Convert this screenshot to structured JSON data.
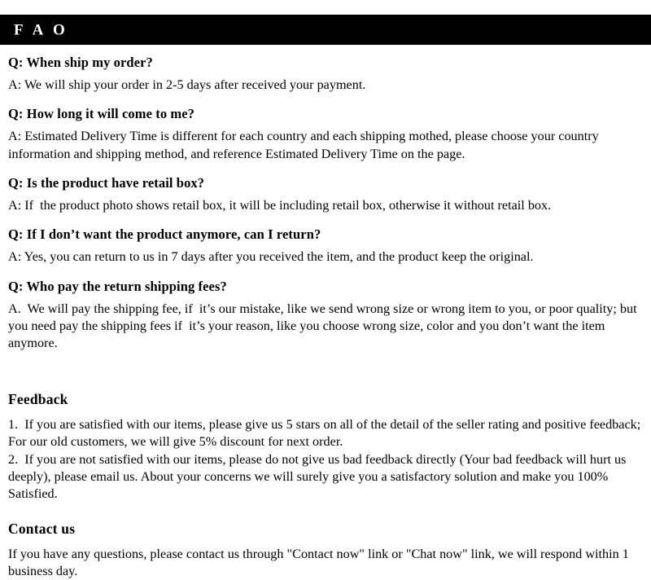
{
  "header": {
    "title": "F A O",
    "background_color": "#000000",
    "text_color": "#ffffff"
  },
  "faq": {
    "items": [
      {
        "question": "Q: When ship my order?",
        "answer": "A: We will ship your order in 2-5 days after received your payment."
      },
      {
        "question": "Q: How long it will come to me?",
        "answer": "A: Estimated Delivery Time is different for each country and each shipping mothed, please choose your country information and shipping method, and reference Estimated Delivery Time on the page."
      },
      {
        "question": "Q: Is the product have retail box?",
        "answer": "A: If  the product photo shows retail box, it will be including retail box, otherwise it without retail box."
      },
      {
        "question": "Q: If  I don’t want the product anymore, can I return?",
        "answer": "A: Yes, you can return to us in 7 days after you received the item, and the product keep the original."
      },
      {
        "question": "Q: Who pay the return shipping fees?",
        "answer": "A.  We will pay the shipping fee, if  it’s our mistake, like we send wrong size or wrong item to you, or poor quality; but you need pay the shipping fees if  it’s your reason, like you choose wrong size, color and you don’t want the item anymore."
      }
    ]
  },
  "feedback": {
    "heading": "Feedback",
    "paragraphs": [
      "1.  If you are satisfied with our items, please give us 5 stars on all of the detail of the seller rating and positive feedback; For our old customers, we will give 5% discount for next order.",
      "2.  If you are not satisfied with our items, please do not give us bad feedback directly (Your bad feedback will hurt us deeply), please email us. About your concerns we will surely give you a satisfactory solution and make you 100% Satisfied."
    ]
  },
  "contact": {
    "heading": "Contact us",
    "paragraphs": [
      "If you have any questions, please contact us through \"Contact now\" link or \"Chat now\" link, we will respond within 1 business day."
    ]
  }
}
